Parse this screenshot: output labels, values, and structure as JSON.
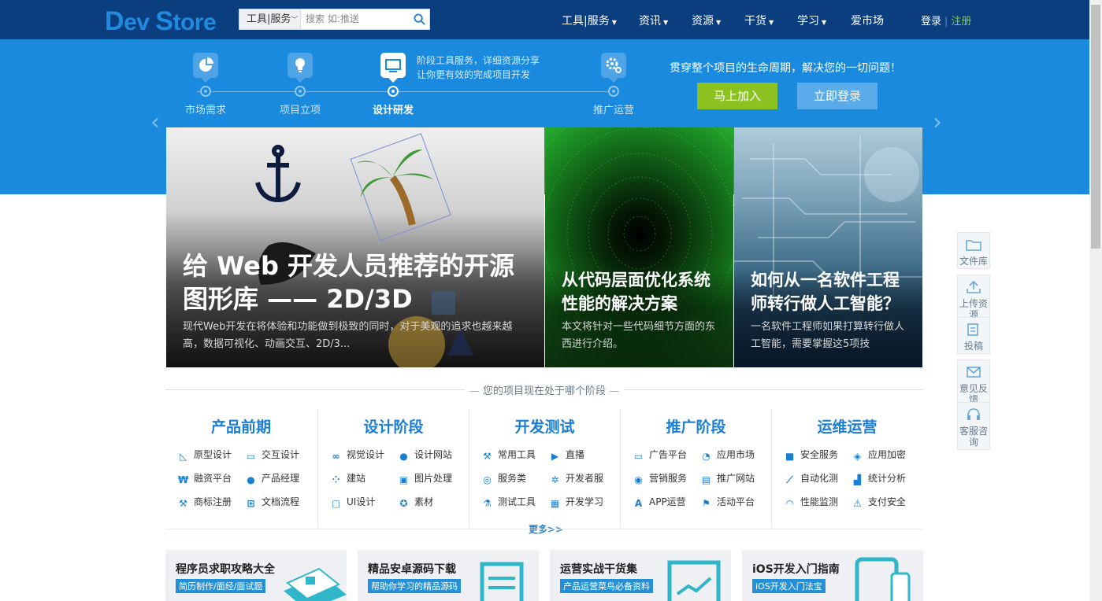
{
  "header": {
    "logo": {
      "part1": "D",
      "part2": "ev ",
      "part3": "S",
      "part4": "tore"
    },
    "search": {
      "category": "工具|服务",
      "placeholder": "搜索 如:推送"
    },
    "nav": [
      "工具|服务",
      "资讯",
      "资源",
      "干货",
      "学习",
      "爱市场"
    ],
    "login": "登录",
    "register": "注册"
  },
  "hero": {
    "stages": [
      "市场需求",
      "项目立项",
      "设计研发",
      "推广运营"
    ],
    "active_stage": "设计研发",
    "desc_line1": "阶段工具服务，详细资源分享",
    "desc_line2": "让你更有效的完成项目开发",
    "slogan": "贯穿整个项目的生命周期，解决您的一切问题！",
    "join_button": "马上加入",
    "login_button": "立即登录",
    "prev_arrow": "‹",
    "next_arrow": "›"
  },
  "features": [
    {
      "title_line1": "给 Web 开发人员推荐的开源",
      "title_line2": "图形库 —— 2D/3D",
      "desc": "现代Web开发在将体验和功能做到极致的同时，对于美观的追求也越来越高，数据可视化、动画交互、2D/3..."
    },
    {
      "title_line1": "从代码层面优化系统",
      "title_line2": "性能的解决方案",
      "desc": "本文将针对一些代码细节方面的东西进行介绍。"
    },
    {
      "title_line1": "如何从一名软件工程",
      "title_line2": "师转行做人工智能？",
      "desc": "一名软件工程师如果打算转行做人工智能，需要掌握这5项技"
    }
  ],
  "stage_section": {
    "heading": "您的项目现在处于哪个阶段",
    "more": "更多>>",
    "columns": [
      {
        "title": "产品前期",
        "links": [
          "原型设计",
          "交互设计",
          "融资平台",
          "产品经理",
          "商标注册",
          "文档流程"
        ]
      },
      {
        "title": "设计阶段",
        "links": [
          "视觉设计",
          "设计网站",
          "建站",
          "图片处理",
          "UI设计",
          "素材"
        ]
      },
      {
        "title": "开发测试",
        "links": [
          "常用工具",
          "直播",
          "服务类",
          "开发者服",
          "测试工具",
          "开发学习"
        ]
      },
      {
        "title": "推广阶段",
        "links": [
          "广告平台",
          "应用市场",
          "营销服务",
          "推广网站",
          "APP运营",
          "活动平台"
        ]
      },
      {
        "title": "运维运营",
        "links": [
          "安全服务",
          "应用加密",
          "自动化测",
          "统计分析",
          "性能监测",
          "支付安全"
        ]
      }
    ]
  },
  "cards": [
    {
      "title": "程序员求职攻略大全",
      "badge": "简历制作/面经/面试题"
    },
    {
      "title": "精品安卓源码下载",
      "badge": "帮助你学习的精品源码"
    },
    {
      "title": "运营实战干货集",
      "badge": "产品运营菜鸟必备资料"
    },
    {
      "title": "iOS开发入门指南",
      "badge": "iOS开发入门法宝"
    }
  ],
  "sidebar": [
    "文件库",
    "上传资源",
    "投稿",
    "意见反馈",
    "客服咨询"
  ],
  "colors": {
    "header_bg": "#0b3e7e",
    "hero_bg": "#1a8ade",
    "accent": "#1a7fd4",
    "join_green": "#8cc220"
  }
}
